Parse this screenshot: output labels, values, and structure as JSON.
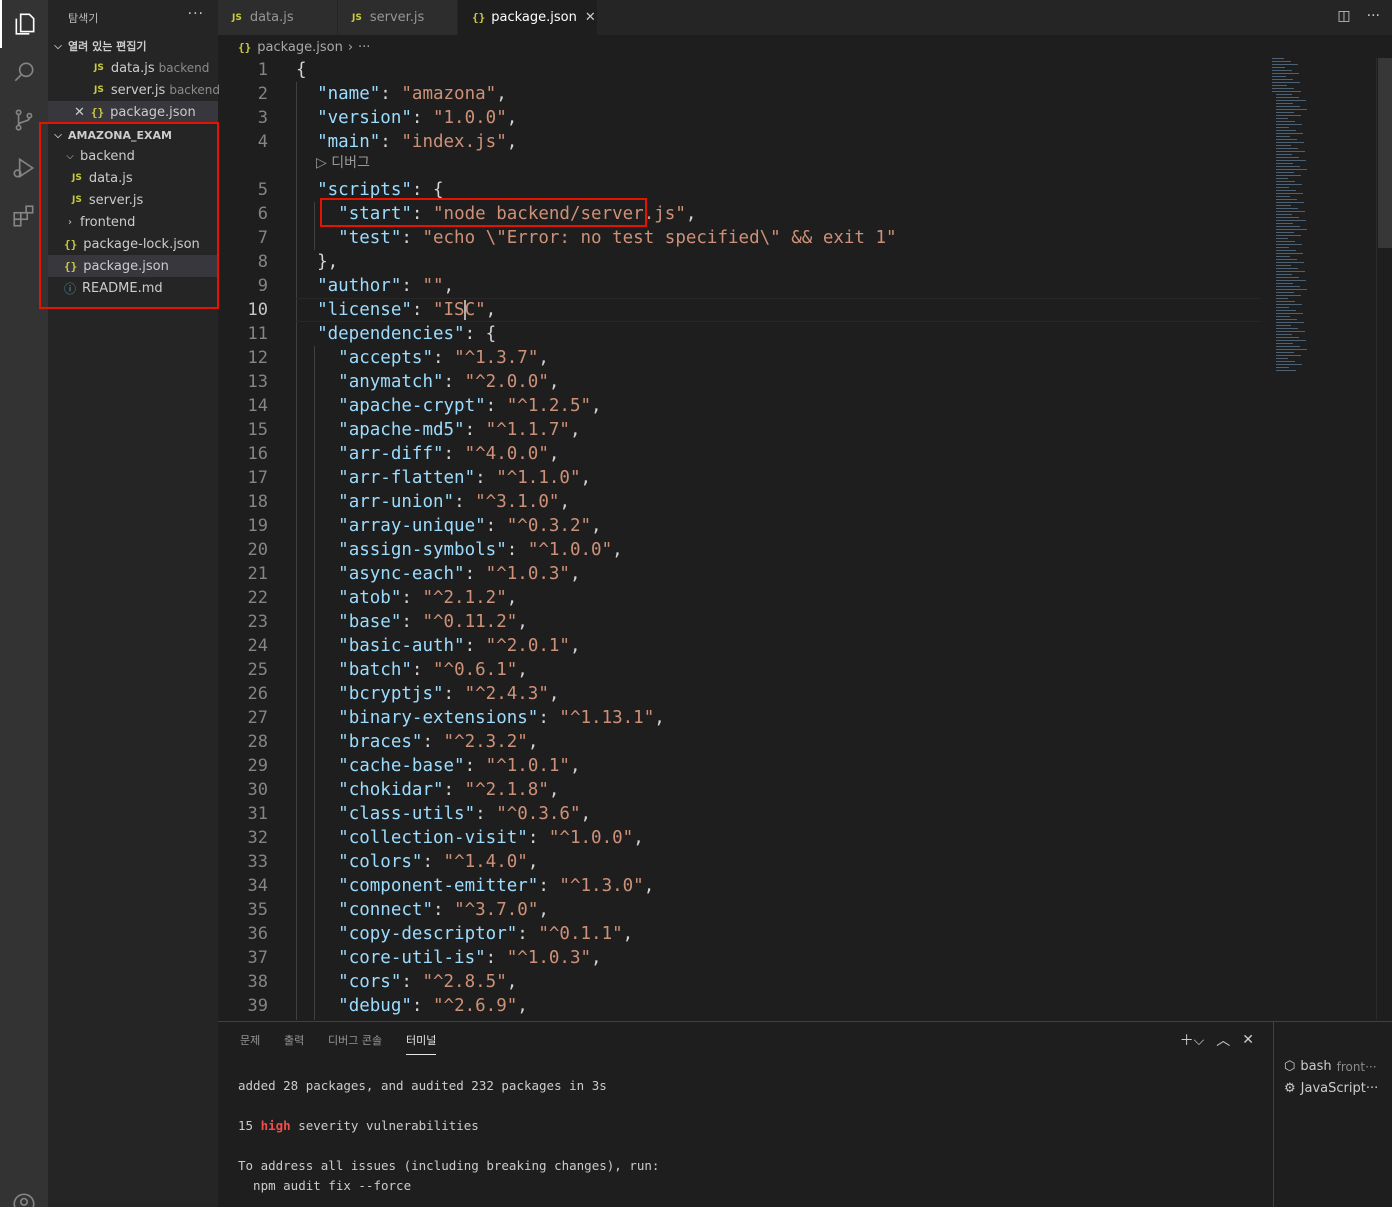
{
  "colors": {
    "accent_red": "#e51400",
    "json_key": "#9cdcfe",
    "json_string": "#ce9178",
    "term_high": "#f14c4c"
  },
  "activity_bar": {
    "icons": [
      "explorer-icon",
      "search-icon",
      "source-control-icon",
      "run-debug-icon",
      "extensions-icon",
      "account-icon"
    ]
  },
  "sidebar": {
    "title": "탐색기",
    "more": "···",
    "open_editors": {
      "label": "열려 있는 편집기",
      "items": [
        {
          "name": "data.js",
          "desc": "backend"
        },
        {
          "name": "server.js",
          "desc": "backend"
        },
        {
          "name": "package.json",
          "desc": ""
        }
      ]
    },
    "workspace": {
      "label": "AMAZONA_EXAM",
      "items": [
        {
          "name": "backend"
        },
        {
          "name": "data.js"
        },
        {
          "name": "server.js"
        },
        {
          "name": "frontend"
        },
        {
          "name": "package-lock.json"
        },
        {
          "name": "package.json"
        },
        {
          "name": "README.md"
        }
      ]
    }
  },
  "tabs": [
    {
      "label": "data.js"
    },
    {
      "label": "server.js"
    },
    {
      "label": "package.json"
    }
  ],
  "breadcrumb": {
    "file": "package.json",
    "rest": "···"
  },
  "editor": {
    "codelens": "디버그",
    "current_line": 10,
    "line_numbers": [
      "1",
      "2",
      "3",
      "4",
      "5",
      "6",
      "7",
      "8",
      "9",
      "10",
      "11",
      "12",
      "13",
      "14",
      "15",
      "16",
      "17",
      "18",
      "19",
      "20",
      "21",
      "22",
      "23",
      "24",
      "25",
      "26",
      "27",
      "28",
      "29",
      "30",
      "31",
      "32",
      "33",
      "34",
      "35",
      "36",
      "37",
      "38",
      "39"
    ],
    "lines": {
      "l1": "{",
      "l2k": "\"name\"",
      "l2v": "\"amazona\"",
      "l3k": "\"version\"",
      "l3v": "\"1.0.0\"",
      "l4k": "\"main\"",
      "l4v": "\"index.js\"",
      "l5k": "\"scripts\"",
      "l6k": "\"start\"",
      "l6v": "\"node backend/server.js\"",
      "l7k": "\"test\"",
      "l7v": "\"echo \\\"Error: no test specified\\\" && exit 1\"",
      "l8": "},",
      "l9k": "\"author\"",
      "l9v": "\"\"",
      "l10k": "\"license\"",
      "l10v": "\"ISC\"",
      "l11k": "\"dependencies\""
    },
    "dependencies": [
      {
        "k": "\"accepts\"",
        "v": "\"^1.3.7\""
      },
      {
        "k": "\"anymatch\"",
        "v": "\"^2.0.0\""
      },
      {
        "k": "\"apache-crypt\"",
        "v": "\"^1.2.5\""
      },
      {
        "k": "\"apache-md5\"",
        "v": "\"^1.1.7\""
      },
      {
        "k": "\"arr-diff\"",
        "v": "\"^4.0.0\""
      },
      {
        "k": "\"arr-flatten\"",
        "v": "\"^1.1.0\""
      },
      {
        "k": "\"arr-union\"",
        "v": "\"^3.1.0\""
      },
      {
        "k": "\"array-unique\"",
        "v": "\"^0.3.2\""
      },
      {
        "k": "\"assign-symbols\"",
        "v": "\"^1.0.0\""
      },
      {
        "k": "\"async-each\"",
        "v": "\"^1.0.3\""
      },
      {
        "k": "\"atob\"",
        "v": "\"^2.1.2\""
      },
      {
        "k": "\"base\"",
        "v": "\"^0.11.2\""
      },
      {
        "k": "\"basic-auth\"",
        "v": "\"^2.0.1\""
      },
      {
        "k": "\"batch\"",
        "v": "\"^0.6.1\""
      },
      {
        "k": "\"bcryptjs\"",
        "v": "\"^2.4.3\""
      },
      {
        "k": "\"binary-extensions\"",
        "v": "\"^1.13.1\""
      },
      {
        "k": "\"braces\"",
        "v": "\"^2.3.2\""
      },
      {
        "k": "\"cache-base\"",
        "v": "\"^1.0.1\""
      },
      {
        "k": "\"chokidar\"",
        "v": "\"^2.1.8\""
      },
      {
        "k": "\"class-utils\"",
        "v": "\"^0.3.6\""
      },
      {
        "k": "\"collection-visit\"",
        "v": "\"^1.0.0\""
      },
      {
        "k": "\"colors\"",
        "v": "\"^1.4.0\""
      },
      {
        "k": "\"component-emitter\"",
        "v": "\"^1.3.0\""
      },
      {
        "k": "\"connect\"",
        "v": "\"^3.7.0\""
      },
      {
        "k": "\"copy-descriptor\"",
        "v": "\"^0.1.1\""
      },
      {
        "k": "\"core-util-is\"",
        "v": "\"^1.0.3\""
      },
      {
        "k": "\"cors\"",
        "v": "\"^2.8.5\""
      },
      {
        "k": "\"debug\"",
        "v": "\"^2.6.9\""
      }
    ]
  },
  "panel": {
    "tabs": [
      "문제",
      "출력",
      "디버그 콘솔",
      "터미널"
    ],
    "terminal": {
      "line1": "added 28 packages, and audited 232 packages in 3s",
      "line2a": "15 ",
      "line2b": "high",
      "line2c": " severity vulnerabilities",
      "line3": "To address all issues (including breaking changes), run:",
      "line4": "  npm audit fix --force"
    },
    "terminals": [
      {
        "name": "bash",
        "sub": "front···"
      },
      {
        "name": "JavaScript···",
        "sub": ""
      }
    ]
  }
}
